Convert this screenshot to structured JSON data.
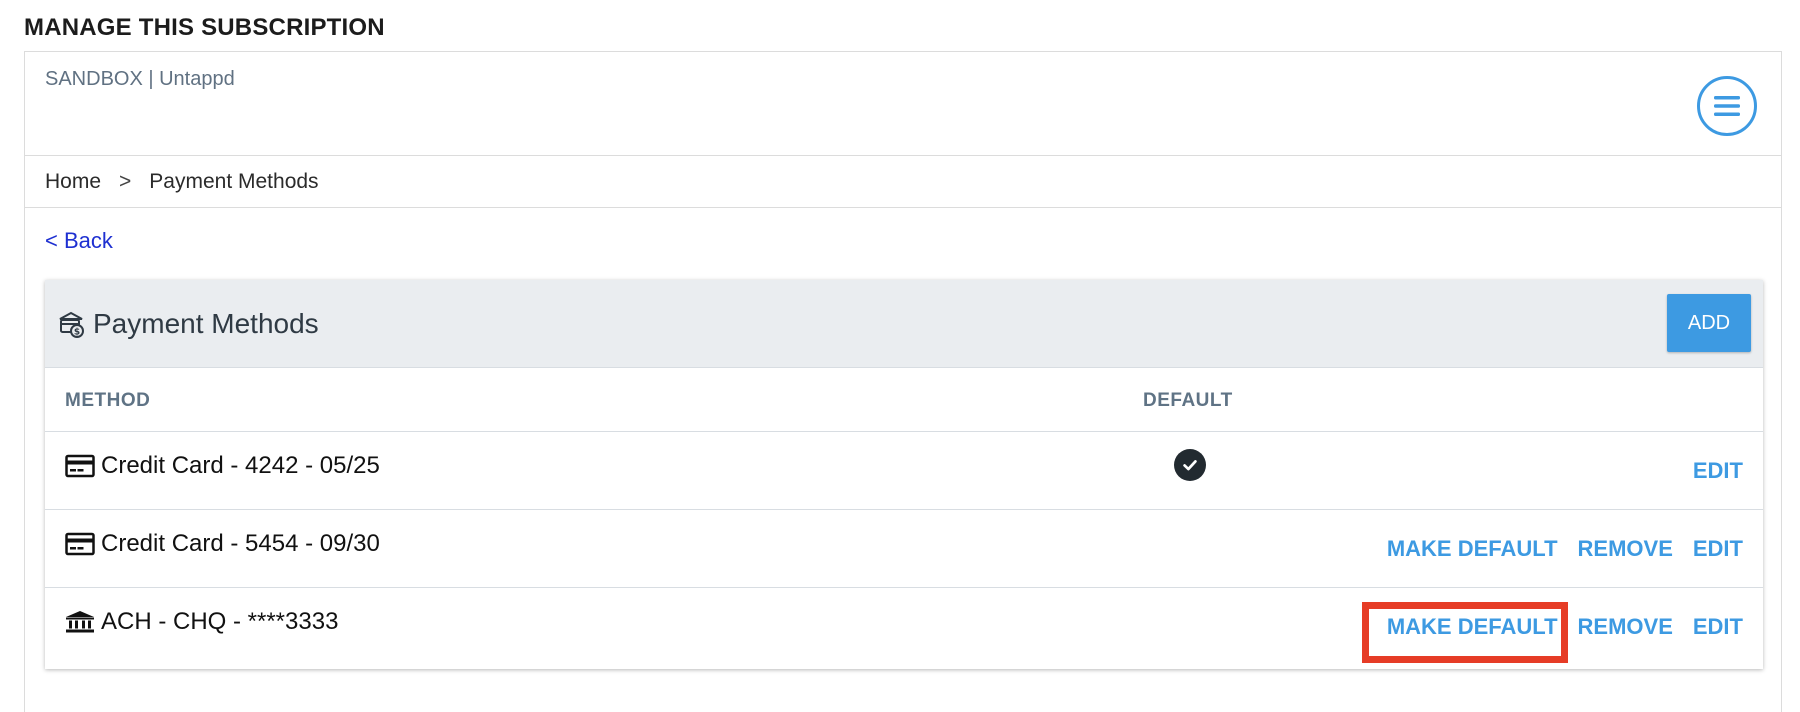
{
  "page_title": "MANAGE THIS SUBSCRIPTION",
  "tenant_label": "SANDBOX | Untappd",
  "breadcrumb": {
    "home": "Home",
    "separator": ">",
    "current": "Payment Methods"
  },
  "back_link": "< Back",
  "card": {
    "title": "Payment Methods",
    "add_label": "ADD",
    "columns": {
      "method": "METHOD",
      "default": "DEFAULT"
    }
  },
  "methods": [
    {
      "icon": "credit-card-icon",
      "label": "Credit Card - 4242 - 05/25",
      "is_default": true,
      "actions": [
        "EDIT"
      ]
    },
    {
      "icon": "credit-card-icon",
      "label": "Credit Card - 5454 - 09/30",
      "is_default": false,
      "actions": [
        "MAKE DEFAULT",
        "REMOVE",
        "EDIT"
      ]
    },
    {
      "icon": "bank-icon",
      "label": "ACH - CHQ - ****3333",
      "is_default": false,
      "actions": [
        "MAKE DEFAULT",
        "REMOVE",
        "EDIT"
      ]
    }
  ],
  "colors": {
    "accent": "#3d9ae2",
    "link": "#1e30d1",
    "highlight": "#e63c26",
    "header_bg": "#eaedf0"
  }
}
